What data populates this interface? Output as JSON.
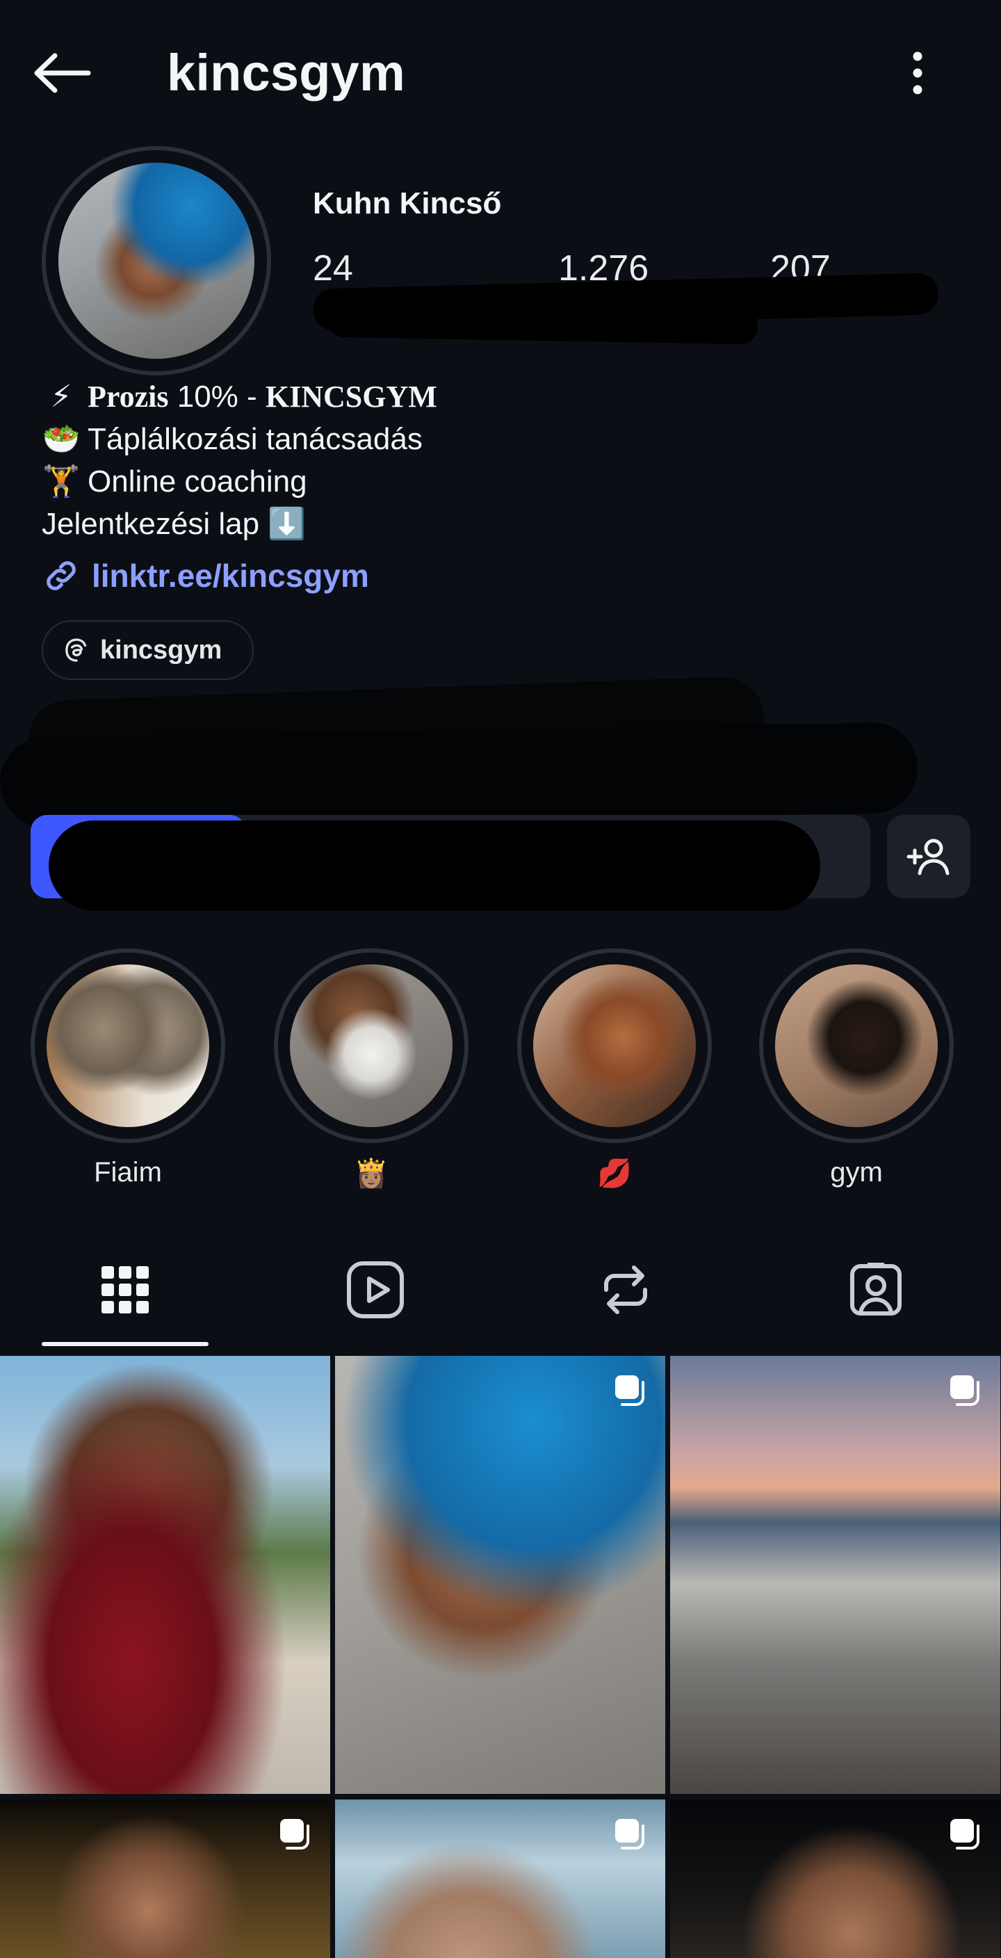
{
  "header": {
    "username": "kincsgym",
    "back_icon": "arrow-left-icon",
    "more_icon": "more-vertical-icon"
  },
  "profile": {
    "display_name": "Kuhn Kincső",
    "stats": {
      "posts": "24",
      "followers": "1.276",
      "following": "207"
    },
    "bio_lines": [
      {
        "emoji": "⚡",
        "text_bold": "Prozis",
        "text": " 10% - ",
        "text_bold2": "KINCSGYM"
      },
      {
        "emoji": "🥗",
        "text": "Táplálkozási tanácsadás"
      },
      {
        "emoji": "🏋️",
        "text": "Online coaching"
      },
      {
        "emoji": "",
        "text": "Jelentkezési lap ⬇️"
      }
    ],
    "link": "linktr.ee/kincsgym",
    "threads_handle": "kincsgym"
  },
  "highlights": [
    {
      "label": "Fiaim"
    },
    {
      "label": "👸🏽"
    },
    {
      "label": "💋"
    },
    {
      "label": "gym"
    }
  ],
  "tabs": [
    {
      "name": "posts",
      "icon": "grid-icon",
      "active": true
    },
    {
      "name": "reels",
      "icon": "play-square-icon",
      "active": false
    },
    {
      "name": "reposts",
      "icon": "repost-icon",
      "active": false
    },
    {
      "name": "tagged",
      "icon": "tagged-person-icon",
      "active": false
    }
  ],
  "colors": {
    "background": "#0b0e14",
    "link": "#8ea0ff",
    "primary": "#3f57ff",
    "button": "#1c2028"
  }
}
